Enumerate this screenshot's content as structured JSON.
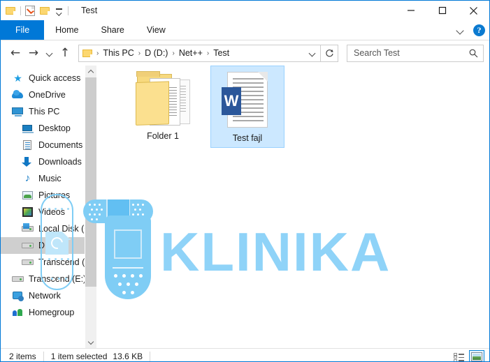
{
  "window": {
    "title": "Test",
    "quick_access_toolbar": [
      {
        "icon": "folder-icon",
        "name": "new-folder"
      },
      {
        "icon": "properties-icon",
        "name": "properties"
      },
      {
        "icon": "folder-icon",
        "name": "folder"
      },
      {
        "icon": "chevron-down-icon",
        "name": "customize-qat"
      }
    ],
    "controls": {
      "minimize": "—",
      "maximize": "☐",
      "close": "✕"
    }
  },
  "ribbon": {
    "tabs": [
      {
        "label": "File",
        "active": true
      },
      {
        "label": "Home",
        "active": false
      },
      {
        "label": "Share",
        "active": false
      },
      {
        "label": "View",
        "active": false
      }
    ],
    "expand_icon": "chevron-down-icon",
    "help_label": "?"
  },
  "address_bar": {
    "back_icon": "←",
    "forward_icon": "→",
    "recent_icon": "chevron-down-icon",
    "up_icon": "↑",
    "breadcrumbs": [
      "This PC",
      "D (D:)",
      "Net++",
      "Test"
    ],
    "separator": "›",
    "dropdown_icon": "chevron-down-icon",
    "refresh_icon": "↻"
  },
  "search": {
    "placeholder": "Search Test",
    "value": "",
    "icon": "search-icon"
  },
  "sidebar": {
    "items": [
      {
        "label": "Quick access",
        "icon": "star-icon",
        "level": 0,
        "selected": false
      },
      {
        "label": "OneDrive",
        "icon": "cloud-icon",
        "level": 0,
        "selected": false
      },
      {
        "label": "This PC",
        "icon": "computer-icon",
        "level": 0,
        "selected": false
      },
      {
        "label": "Desktop",
        "icon": "desktop-icon",
        "level": 1,
        "selected": false
      },
      {
        "label": "Documents",
        "icon": "documents-icon",
        "level": 1,
        "selected": false
      },
      {
        "label": "Downloads",
        "icon": "download-icon",
        "level": 1,
        "selected": false
      },
      {
        "label": "Music",
        "icon": "music-note-icon",
        "level": 1,
        "selected": false
      },
      {
        "label": "Pictures",
        "icon": "pictures-icon",
        "level": 1,
        "selected": false
      },
      {
        "label": "Videos",
        "icon": "videos-icon",
        "level": 1,
        "selected": false
      },
      {
        "label": "Local Disk (C:)",
        "icon": "windows-drive-icon",
        "level": 1,
        "selected": false
      },
      {
        "label": "D (D:)",
        "icon": "drive-icon",
        "level": 1,
        "selected": true
      },
      {
        "label": "Transcend (E:)",
        "icon": "drive-icon",
        "level": 1,
        "selected": false
      },
      {
        "label": "Transcend (E:)",
        "icon": "drive-icon",
        "level": 0,
        "selected": false
      },
      {
        "label": "Network",
        "icon": "network-icon",
        "level": 0,
        "selected": false
      },
      {
        "label": "Homegroup",
        "icon": "homegroup-icon",
        "level": 0,
        "selected": false
      }
    ],
    "scrollbar": {
      "up_icon": "chevron-up-icon",
      "down_icon": "chevron-down-icon"
    }
  },
  "files": [
    {
      "name": "Folder 1",
      "type": "folder",
      "icon": "folder-with-documents-icon",
      "selected": false
    },
    {
      "name": "Test fajl",
      "type": "word-document",
      "icon": "word-document-icon",
      "selected": true,
      "badge": "W"
    }
  ],
  "watermark": {
    "text": "KLINIKA",
    "color": "#8fd3f8",
    "graphics": [
      "bandage-icon",
      "remote-control-icon",
      "thermometer-icon"
    ]
  },
  "status_bar": {
    "item_count": "2 items",
    "selection": "1 item selected",
    "size": "13.6 KB",
    "views": [
      {
        "name": "details-view",
        "active": false
      },
      {
        "name": "large-icons-view",
        "active": true
      }
    ]
  }
}
